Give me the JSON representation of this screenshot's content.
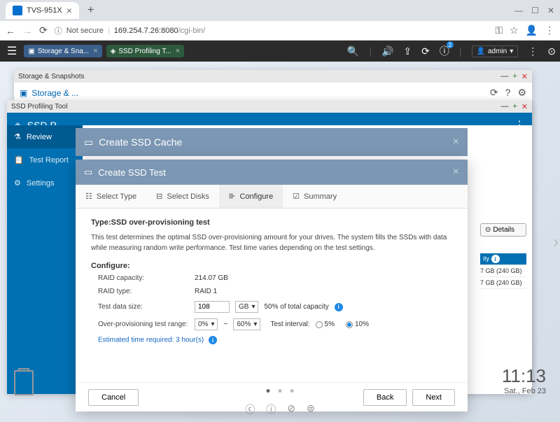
{
  "browser": {
    "tab_title": "TVS-951X",
    "url_warning": "Not secure",
    "url_host": "169.254.7.26:8080",
    "url_path": "/cgi-bin/"
  },
  "qnap_bar": {
    "tab1": "Storage & Sna...",
    "tab2": "SSD Profiling T...",
    "admin": "admin"
  },
  "window_storage": {
    "title": "Storage & Snapshots",
    "app_title": "Storage & ..."
  },
  "window_ssdp": {
    "win_title": "SSD Profiling Tool",
    "app_title": "SSD P",
    "side_review": "Review",
    "side_reports": "Test Report",
    "side_settings": "Settings",
    "details_btn": "Details",
    "cache_header": "ity",
    "drive1": "7 GB (240 GB)",
    "drive2": "7 GB (240 GB)"
  },
  "modal_cache": {
    "title": "Create SSD Cache"
  },
  "modal_test": {
    "title": "Create SSD Test",
    "step1": "Select Type",
    "step2": "Select Disks",
    "step3": "Configure",
    "step4": "Summary",
    "type_label": "Type:SSD over-provisioning test",
    "description": "This test determines the optimal SSD over-provisioning amount for your drives. The system fills the SSDs with data while measuring random write performance. Test time varies depending on the test settings.",
    "configure_label": "Configure:",
    "raid_cap_label": "RAID capacity:",
    "raid_cap_value": "214.07 GB",
    "raid_type_label": "RAID type:",
    "raid_type_value": "RAID 1",
    "test_size_label": "Test data size:",
    "test_size_value": "108",
    "test_size_unit": "GB",
    "test_size_pct": "50% of total capacity",
    "op_range_label": "Over-provisioning test range:",
    "op_min": "0%",
    "op_sep": "~",
    "op_max": "60%",
    "interval_label": "Test interval:",
    "interval_5": "5%",
    "interval_10": "10%",
    "estimated": "Estimated time required: 3 hour(s)",
    "cancel": "Cancel",
    "back": "Back",
    "next": "Next"
  },
  "clock": {
    "time": "11:13",
    "date": "Sat., Feb 23"
  }
}
